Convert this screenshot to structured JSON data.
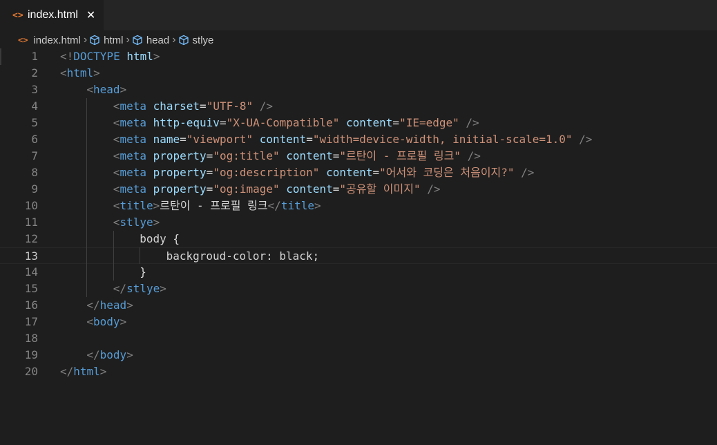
{
  "tab": {
    "label": "index.html",
    "icon": "html-file-icon",
    "close": "✕"
  },
  "breadcrumb": [
    {
      "label": "index.html",
      "icon": "html-file-icon"
    },
    {
      "label": "html",
      "icon": "symbol-element-icon"
    },
    {
      "label": "head",
      "icon": "symbol-element-icon"
    },
    {
      "label": "stlye",
      "icon": "symbol-element-icon"
    }
  ],
  "editor": {
    "active_line": 13,
    "lines": [
      {
        "n": "1",
        "indent": 0,
        "tokens": [
          [
            "br",
            "<!"
          ],
          [
            "tag",
            "DOCTYPE"
          ],
          [
            "txt",
            " "
          ],
          [
            "attr",
            "html"
          ],
          [
            "br",
            ">"
          ]
        ]
      },
      {
        "n": "2",
        "indent": 0,
        "tokens": [
          [
            "br",
            "<"
          ],
          [
            "tag",
            "html"
          ],
          [
            "br",
            ">"
          ]
        ]
      },
      {
        "n": "3",
        "indent": 1,
        "tokens": [
          [
            "br",
            "<"
          ],
          [
            "tag",
            "head"
          ],
          [
            "br",
            ">"
          ]
        ]
      },
      {
        "n": "4",
        "indent": 2,
        "tokens": [
          [
            "br",
            "<"
          ],
          [
            "tag",
            "meta"
          ],
          [
            "txt",
            " "
          ],
          [
            "attr",
            "charset"
          ],
          [
            "txt",
            "="
          ],
          [
            "str",
            "\"UTF-8\""
          ],
          [
            "txt",
            " "
          ],
          [
            "br",
            "/>"
          ]
        ]
      },
      {
        "n": "5",
        "indent": 2,
        "tokens": [
          [
            "br",
            "<"
          ],
          [
            "tag",
            "meta"
          ],
          [
            "txt",
            " "
          ],
          [
            "attr",
            "http-equiv"
          ],
          [
            "txt",
            "="
          ],
          [
            "str",
            "\"X-UA-Compatible\""
          ],
          [
            "txt",
            " "
          ],
          [
            "attr",
            "content"
          ],
          [
            "txt",
            "="
          ],
          [
            "str",
            "\"IE=edge\""
          ],
          [
            "txt",
            " "
          ],
          [
            "br",
            "/>"
          ]
        ]
      },
      {
        "n": "6",
        "indent": 2,
        "tokens": [
          [
            "br",
            "<"
          ],
          [
            "tag",
            "meta"
          ],
          [
            "txt",
            " "
          ],
          [
            "attr",
            "name"
          ],
          [
            "txt",
            "="
          ],
          [
            "str",
            "\"viewport\""
          ],
          [
            "txt",
            " "
          ],
          [
            "attr",
            "content"
          ],
          [
            "txt",
            "="
          ],
          [
            "str",
            "\"width=device-width, initial-scale=1.0\""
          ],
          [
            "txt",
            " "
          ],
          [
            "br",
            "/>"
          ]
        ]
      },
      {
        "n": "7",
        "indent": 2,
        "tokens": [
          [
            "br",
            "<"
          ],
          [
            "tag",
            "meta"
          ],
          [
            "txt",
            " "
          ],
          [
            "attr",
            "property"
          ],
          [
            "txt",
            "="
          ],
          [
            "str",
            "\"og:title\""
          ],
          [
            "txt",
            " "
          ],
          [
            "attr",
            "content"
          ],
          [
            "txt",
            "="
          ],
          [
            "str",
            "\"르탄이 - 프로필 링크\""
          ],
          [
            "txt",
            " "
          ],
          [
            "br",
            "/>"
          ]
        ]
      },
      {
        "n": "8",
        "indent": 2,
        "tokens": [
          [
            "br",
            "<"
          ],
          [
            "tag",
            "meta"
          ],
          [
            "txt",
            " "
          ],
          [
            "attr",
            "property"
          ],
          [
            "txt",
            "="
          ],
          [
            "str",
            "\"og:description\""
          ],
          [
            "txt",
            " "
          ],
          [
            "attr",
            "content"
          ],
          [
            "txt",
            "="
          ],
          [
            "str",
            "\"어서와 코딩은 처음이지?\""
          ],
          [
            "txt",
            " "
          ],
          [
            "br",
            "/>"
          ]
        ]
      },
      {
        "n": "9",
        "indent": 2,
        "tokens": [
          [
            "br",
            "<"
          ],
          [
            "tag",
            "meta"
          ],
          [
            "txt",
            " "
          ],
          [
            "attr",
            "property"
          ],
          [
            "txt",
            "="
          ],
          [
            "str",
            "\"og:image\""
          ],
          [
            "txt",
            " "
          ],
          [
            "attr",
            "content"
          ],
          [
            "txt",
            "="
          ],
          [
            "str",
            "\"공유할 이미지\""
          ],
          [
            "txt",
            " "
          ],
          [
            "br",
            "/>"
          ]
        ]
      },
      {
        "n": "10",
        "indent": 2,
        "tokens": [
          [
            "br",
            "<"
          ],
          [
            "tag",
            "title"
          ],
          [
            "br",
            ">"
          ],
          [
            "txt",
            "르탄이 - 프로필 링크"
          ],
          [
            "br",
            "</"
          ],
          [
            "tag",
            "title"
          ],
          [
            "br",
            ">"
          ]
        ]
      },
      {
        "n": "11",
        "indent": 2,
        "tokens": [
          [
            "br",
            "<"
          ],
          [
            "tag",
            "stlye"
          ],
          [
            "br",
            ">"
          ]
        ]
      },
      {
        "n": "12",
        "indent": 3,
        "tokens": [
          [
            "txt",
            "body {"
          ]
        ]
      },
      {
        "n": "13",
        "indent": 4,
        "tokens": [
          [
            "txt",
            "backgroud-color: black;"
          ]
        ]
      },
      {
        "n": "14",
        "indent": 3,
        "tokens": [
          [
            "txt",
            "}"
          ]
        ]
      },
      {
        "n": "15",
        "indent": 2,
        "tokens": [
          [
            "br",
            "</"
          ],
          [
            "tag",
            "stlye"
          ],
          [
            "br",
            ">"
          ]
        ]
      },
      {
        "n": "16",
        "indent": 1,
        "tokens": [
          [
            "br",
            "</"
          ],
          [
            "tag",
            "head"
          ],
          [
            "br",
            ">"
          ]
        ]
      },
      {
        "n": "17",
        "indent": 1,
        "tokens": [
          [
            "br",
            "<"
          ],
          [
            "tag",
            "body"
          ],
          [
            "br",
            ">"
          ]
        ]
      },
      {
        "n": "18",
        "indent": 0,
        "tokens": []
      },
      {
        "n": "19",
        "indent": 1,
        "tokens": [
          [
            "br",
            "</"
          ],
          [
            "tag",
            "body"
          ],
          [
            "br",
            ">"
          ]
        ]
      },
      {
        "n": "20",
        "indent": 0,
        "tokens": [
          [
            "br",
            "</"
          ],
          [
            "tag",
            "html"
          ],
          [
            "br",
            ">"
          ]
        ]
      }
    ]
  }
}
